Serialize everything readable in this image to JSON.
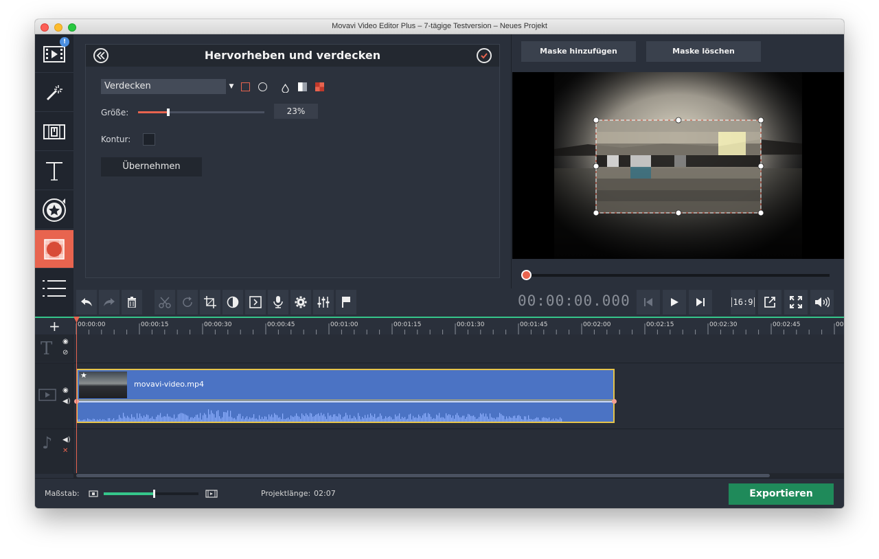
{
  "window": {
    "title": "Movavi Video Editor Plus – 7-tägige Testversion – Neues Projekt"
  },
  "sidebar": {
    "badge": "!",
    "items": [
      {
        "name": "import-media",
        "icon": "film-import-icon"
      },
      {
        "name": "filters",
        "icon": "magic-wand-icon"
      },
      {
        "name": "transitions",
        "icon": "transition-icon"
      },
      {
        "name": "titles",
        "icon": "text-icon"
      },
      {
        "name": "stickers",
        "icon": "star-sticker-icon"
      },
      {
        "name": "highlight-conceal",
        "icon": "pixel-mask-icon",
        "active": true
      },
      {
        "name": "more-tools",
        "icon": "list-icon"
      }
    ]
  },
  "panel": {
    "title": "Hervorheben und verdecken",
    "mode_value": "Verdecken",
    "size_label": "Größe:",
    "size_value": "23%",
    "size_fraction": 0.23,
    "contour_label": "Kontur:",
    "apply_label": "Übernehmen"
  },
  "preview": {
    "add_mask": "Maske hinzufügen",
    "delete_mask": "Maske löschen"
  },
  "transport": {
    "timecode": "00:00:00.000",
    "aspect": "16:9"
  },
  "timeline": {
    "ticks": [
      "00:00:00",
      "00:00:15",
      "00:00:30",
      "00:00:45",
      "00:01:00",
      "00:01:15",
      "00:01:30",
      "00:01:45",
      "00:02:00",
      "00:02:15",
      "00:02:30",
      "00:02:45",
      "00"
    ],
    "clip_name": "movavi-video.mp4"
  },
  "footer": {
    "scale_label": "Maßstab:",
    "project_length_label": "Projektlänge:",
    "project_length_value": "02:07",
    "export_label": "Exportieren",
    "zoom_fraction": 0.52
  },
  "colors": {
    "accent": "#e8644f",
    "timeline_accent": "#35c68b",
    "export": "#1f8a5a",
    "clip": "#4b73c4",
    "clip_border": "#e6c44a"
  }
}
